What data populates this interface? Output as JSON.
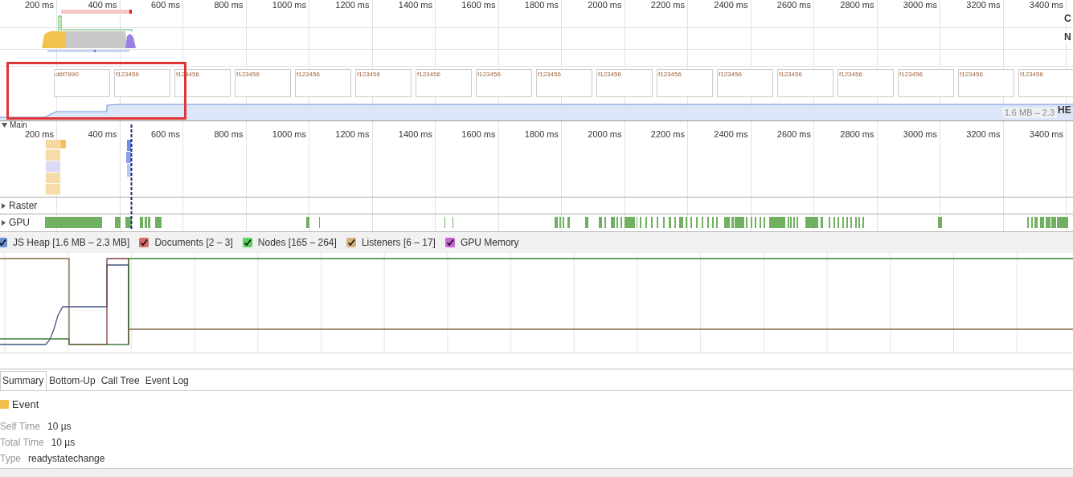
{
  "overview": {
    "ruler": [
      "200 ms",
      "400 ms",
      "600 ms",
      "800 ms",
      "1000 ms",
      "1200 ms",
      "1400 ms",
      "1600 ms",
      "1800 ms",
      "2000 ms",
      "2200 ms",
      "2400 ms",
      "2600 ms",
      "2800 ms",
      "3000 ms",
      "3200 ms",
      "3400 ms"
    ],
    "track_labels": [
      "C",
      "N"
    ],
    "filmstrip": [
      {
        "label": "d6f7890"
      },
      {
        "label": "f123456"
      },
      {
        "label": "f123456"
      },
      {
        "label": "f123456"
      },
      {
        "label": "f123456"
      },
      {
        "label": "f123456"
      },
      {
        "label": "f123456"
      },
      {
        "label": "f123456"
      },
      {
        "label": "f123456"
      },
      {
        "label": "f123456"
      },
      {
        "label": "f123456"
      },
      {
        "label": "f123456"
      },
      {
        "label": "f123456"
      },
      {
        "label": "f123456"
      },
      {
        "label": "f123456"
      },
      {
        "label": "f123456"
      },
      {
        "label": "f123456"
      }
    ],
    "heap_label": "HE",
    "heap_range": "1.6 MB – 2.3"
  },
  "main": {
    "label": "Main",
    "expanded": true,
    "ruler": [
      "200 ms",
      "400 ms",
      "600 ms",
      "800 ms",
      "1000 ms",
      "1200 ms",
      "1400 ms",
      "1600 ms",
      "1800 ms",
      "2000 ms",
      "2200 ms",
      "2400 ms",
      "2600 ms",
      "2800 ms",
      "3000 ms",
      "3200 ms",
      "3400 ms"
    ]
  },
  "tracks": [
    {
      "label": "Raster",
      "expanded": false
    },
    {
      "label": "GPU",
      "expanded": false
    }
  ],
  "counters": [
    {
      "label": "JS Heap [1.6 MB – 2.3 MB]",
      "checked": true,
      "color": "#6a8fd6"
    },
    {
      "label": "Documents [2 – 3]",
      "checked": true,
      "color": "#d26a6a"
    },
    {
      "label": "Nodes [165 – 264]",
      "checked": true,
      "color": "#5dd15d"
    },
    {
      "label": "Listeners [6 – 17]",
      "checked": true,
      "color": "#d7b07a"
    },
    {
      "label": "GPU Memory",
      "checked": true,
      "color": "#c764d3"
    }
  ],
  "tabs": [
    {
      "label": "Summary",
      "selected": true
    },
    {
      "label": "Bottom-Up",
      "selected": false
    },
    {
      "label": "Call Tree",
      "selected": false
    },
    {
      "label": "Event Log",
      "selected": false
    }
  ],
  "summary": {
    "title": "Event",
    "color": "#f0c04c",
    "rows": [
      {
        "label": "Self Time",
        "value": "10 µs"
      },
      {
        "label": "Total Time",
        "value": "10 µs"
      },
      {
        "label": "Type",
        "value": "readystatechange"
      }
    ]
  }
}
